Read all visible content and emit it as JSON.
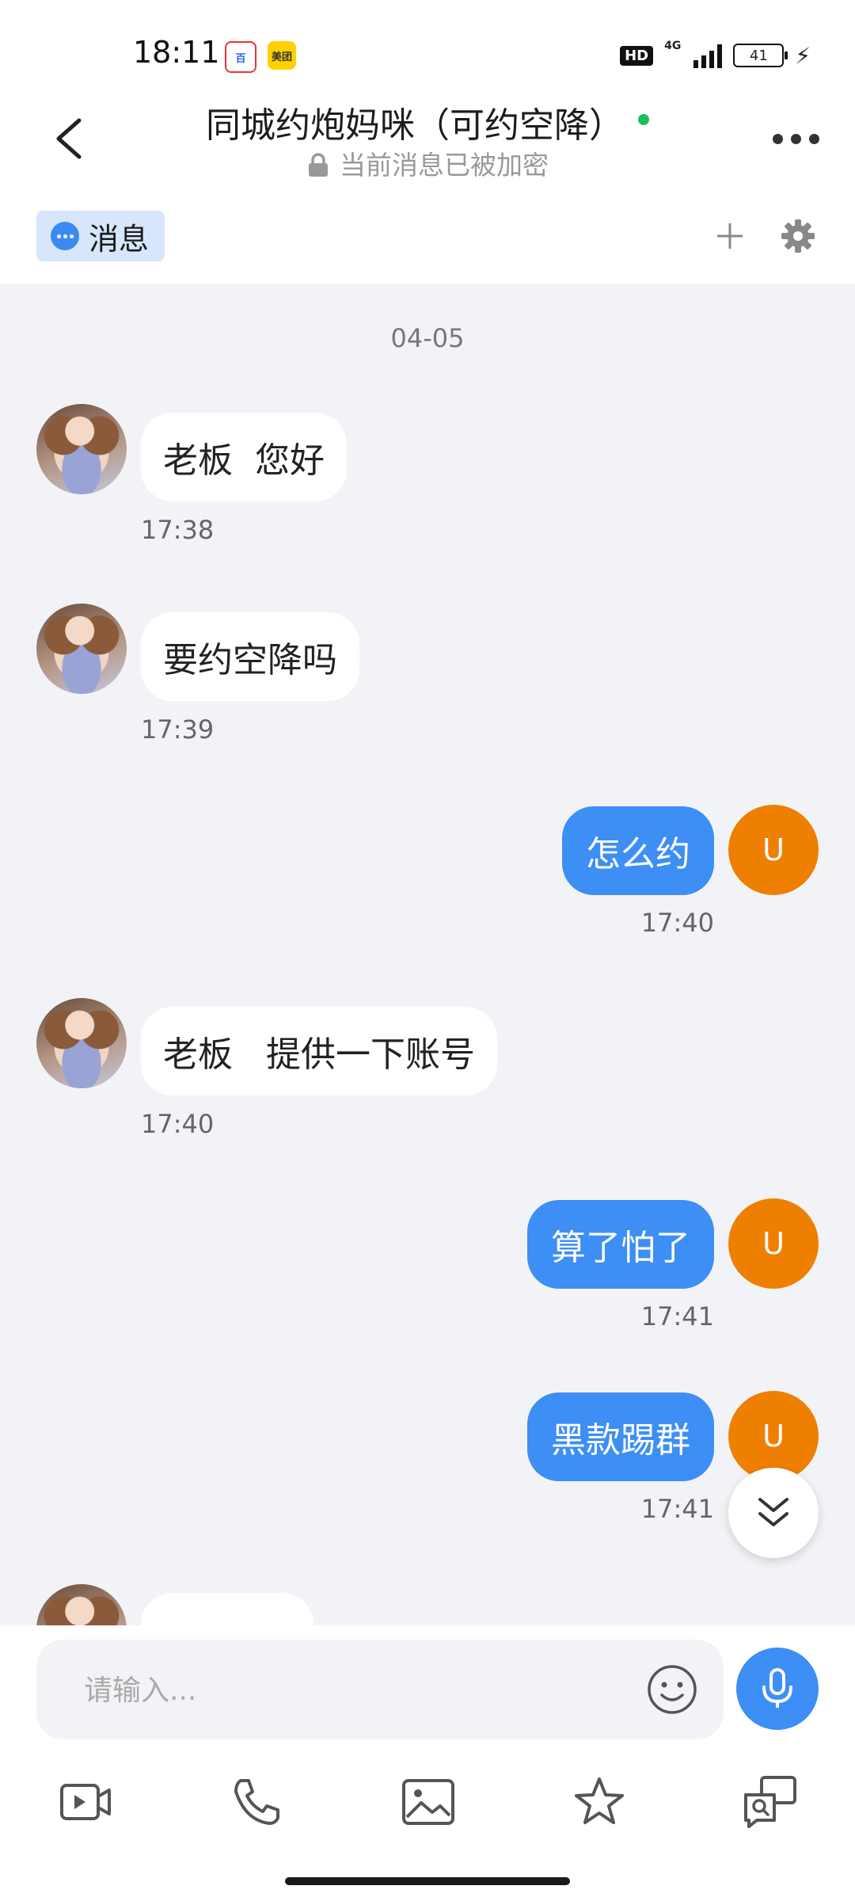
{
  "status_bar": {
    "time": "18:11",
    "apps": [
      "百度",
      "美团"
    ],
    "hd": "HD",
    "network": "4G",
    "battery": "41"
  },
  "header": {
    "title": "同城约炮妈咪（可约空降）",
    "subtitle": "当前消息已被加密",
    "online_color": "#19c05a"
  },
  "tabs": {
    "active_label": "消息"
  },
  "chat": {
    "date": "04-05",
    "my_avatar_letter": "U",
    "messages": [
      {
        "side": "left",
        "text": "老板  您好",
        "time": "17:38"
      },
      {
        "side": "left",
        "text": "要约空降吗",
        "time": "17:39"
      },
      {
        "side": "right",
        "text": "怎么约",
        "time": "17:40"
      },
      {
        "side": "left",
        "text": "老板   提供一下账号",
        "time": "17:40"
      },
      {
        "side": "right",
        "text": "算了怕了",
        "time": "17:41"
      },
      {
        "side": "right",
        "text": "黑款踢群",
        "time": "17:41"
      }
    ]
  },
  "input": {
    "placeholder": "请输入..."
  },
  "colors": {
    "accent": "#3d8ef5",
    "my_avatar": "#ef7f00",
    "background": "#f2f3f7"
  },
  "icons": [
    "back-icon",
    "more-icon",
    "message-icon",
    "plus-icon",
    "gear-icon",
    "chevron-double-down-icon",
    "emoji-icon",
    "microphone-icon",
    "video-icon",
    "phone-icon",
    "image-icon",
    "star-icon",
    "search-chat-icon"
  ]
}
